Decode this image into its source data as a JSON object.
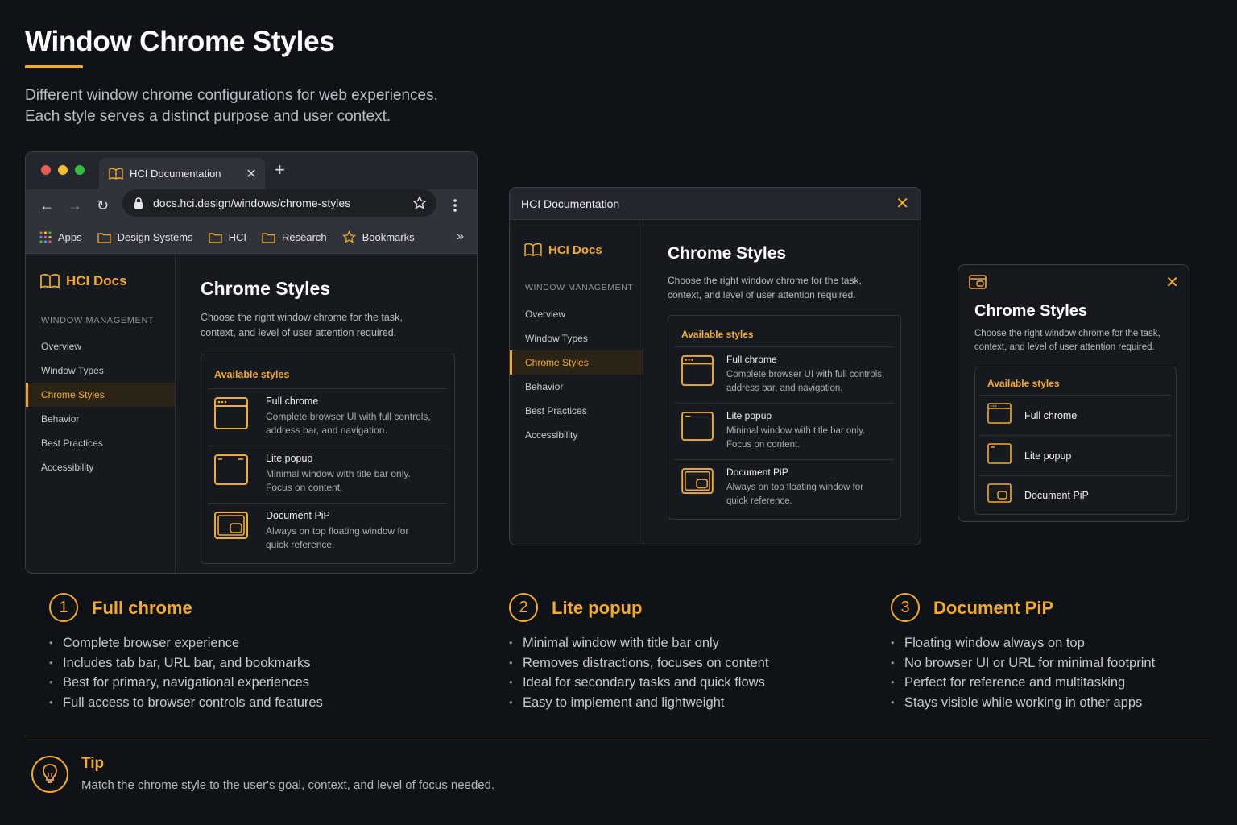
{
  "header": {
    "title": "Window Chrome Styles",
    "subtitle_line1": "Different window chrome configurations for web experiences.",
    "subtitle_line2": "Each style serves a distinct purpose and user context."
  },
  "browser": {
    "tab_title": "HCI Documentation",
    "url": "docs.hci.design/windows/chrome-styles",
    "bookmarks": [
      "Apps",
      "Design Systems",
      "HCI",
      "Research",
      "Bookmarks"
    ]
  },
  "popup": {
    "title": "HCI Documentation"
  },
  "docs": {
    "brand": "HCI Docs",
    "section": "WINDOW MANAGEMENT",
    "nav": [
      "Overview",
      "Window Types",
      "Chrome Styles",
      "Behavior",
      "Best Practices",
      "Accessibility"
    ],
    "active_nav": "Chrome Styles",
    "heading": "Chrome Styles",
    "desc_line1": "Choose the right window chrome for the task,",
    "desc_line2": "context, and level of user attention required.",
    "card_title": "Available styles",
    "styles": [
      {
        "title": "Full chrome",
        "desc1": "Complete browser UI with full controls,",
        "desc2": "address bar, and navigation.",
        "icon": "full-chrome-icon"
      },
      {
        "title": "Lite popup",
        "desc1": "Minimal window with title bar only.",
        "desc2": "Focus on content.",
        "icon": "lite-popup-icon"
      },
      {
        "title": "Document PiP",
        "desc1": "Always on top floating window for",
        "desc2": "quick reference.",
        "icon": "document-pip-icon"
      }
    ]
  },
  "columns": [
    {
      "num": "1",
      "title": "Full chrome",
      "bullets": [
        "Complete browser experience",
        "Includes tab bar, URL bar, and bookmarks",
        "Best for primary, navigational experiences",
        "Full access to browser controls and features"
      ]
    },
    {
      "num": "2",
      "title": "Lite popup",
      "bullets": [
        "Minimal window with title bar only",
        "Removes distractions, focuses on content",
        "Ideal for secondary tasks and quick flows",
        "Easy to implement and lightweight"
      ]
    },
    {
      "num": "3",
      "title": "Document PiP",
      "bullets": [
        "Floating window always on top",
        "No browser UI or URL for minimal footprint",
        "Perfect for reference and multitasking",
        "Stays visible while working in other apps"
      ]
    }
  ],
  "tip": {
    "title": "Tip",
    "text": "Match the chrome style to the user's goal, context, and level of focus needed."
  },
  "colors": {
    "accent": "#f2aa2b",
    "background": "#0f1217"
  }
}
